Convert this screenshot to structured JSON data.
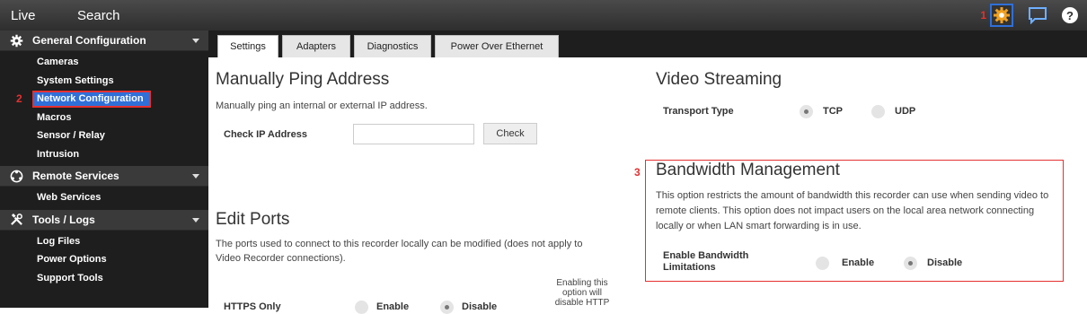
{
  "topbar": {
    "nav": [
      "Live",
      "Search"
    ],
    "settings_marker": "1",
    "icons": [
      "gear-icon",
      "chat-icon",
      "help-icon"
    ]
  },
  "sidebar": {
    "sections": [
      {
        "title": "General Configuration",
        "icon": "gear-icon",
        "items": [
          {
            "label": "Cameras"
          },
          {
            "label": "System Settings"
          },
          {
            "label": "Network Configuration",
            "selected": true,
            "marker": "2"
          },
          {
            "label": "Macros"
          },
          {
            "label": "Sensor / Relay"
          },
          {
            "label": "Intrusion"
          }
        ]
      },
      {
        "title": "Remote Services",
        "icon": "remote-icon",
        "items": [
          {
            "label": "Web Services"
          }
        ]
      },
      {
        "title": "Tools / Logs",
        "icon": "tools-icon",
        "items": [
          {
            "label": "Log Files"
          },
          {
            "label": "Power Options"
          },
          {
            "label": "Support Tools"
          }
        ]
      }
    ]
  },
  "tabs": [
    {
      "label": "Settings",
      "active": true
    },
    {
      "label": "Adapters"
    },
    {
      "label": "Diagnostics"
    },
    {
      "label": "Power Over Ethernet"
    }
  ],
  "ping": {
    "title": "Manually Ping Address",
    "desc": "Manually ping an internal or external IP address.",
    "label": "Check IP Address",
    "value": "",
    "button": "Check"
  },
  "ports": {
    "title": "Edit Ports",
    "desc_line1": "The ports used to connect to this recorder locally can be modified (does not apply to",
    "desc_line2": "Video Recorder connections).",
    "https_label": "HTTPS Only",
    "enable": "Enable",
    "disable": "Disable",
    "note": "Enabling this option will disable HTTP"
  },
  "streaming": {
    "title": "Video Streaming",
    "label": "Transport Type",
    "opt1": "TCP",
    "opt2": "UDP",
    "selected": "TCP"
  },
  "bandwidth": {
    "marker": "3",
    "title": "Bandwidth Management",
    "desc_line1": "This option restricts the amount of bandwidth this recorder can use when sending video to",
    "desc_line2": "remote clients. This option does not impact users on the local area network connecting",
    "desc_line3": "locally or when LAN smart forwarding is in use.",
    "label_line1": "Enable Bandwidth",
    "label_line2": "Limitations",
    "enable": "Enable",
    "disable": "Disable",
    "selected": "Disable"
  },
  "colors": {
    "accent": "#2f6fd8",
    "highlight": "#e53030",
    "gear": "#f0a020"
  }
}
